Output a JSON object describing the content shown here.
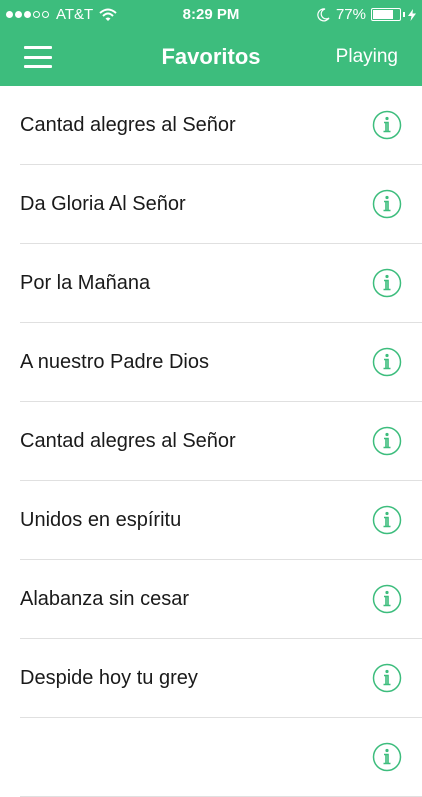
{
  "status_bar": {
    "carrier": "AT&T",
    "time": "8:29 PM",
    "battery": "77%",
    "battery_level": 0.77,
    "signal_bars": 3,
    "signal_total": 5,
    "icons": [
      "wifi-icon",
      "moon-icon",
      "battery-icon",
      "charging-bolt-icon"
    ]
  },
  "header": {
    "title": "Favoritos",
    "playing_label": "Playing",
    "menu_icon": "hamburger-menu-icon",
    "background": "#3dbd7d"
  },
  "accent_color": "#3dbd7d",
  "songs": [
    {
      "title": "Cantad alegres al Señor"
    },
    {
      "title": "Da Gloria Al Señor"
    },
    {
      "title": "Por la Mañana"
    },
    {
      "title": "A nuestro Padre Dios"
    },
    {
      "title": "Cantad alegres al Señor"
    },
    {
      "title": "Unidos en espíritu"
    },
    {
      "title": "Alabanza sin cesar"
    },
    {
      "title": "Despide hoy tu grey"
    },
    {
      "title": ""
    }
  ],
  "row_icon": "info-icon"
}
